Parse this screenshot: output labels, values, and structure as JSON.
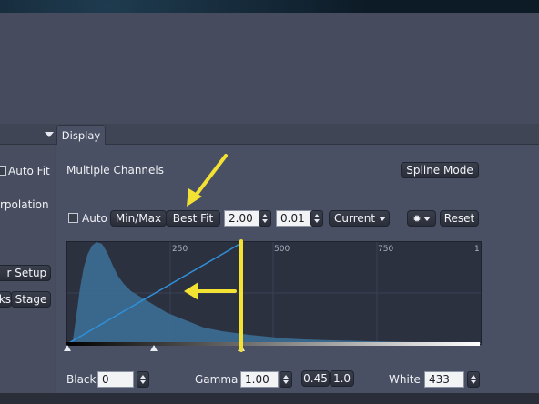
{
  "left_panel": {
    "auto_fit_label": "Auto Fit",
    "interpolation_label": "rpolation",
    "setup_button": "r Setup",
    "marks_button": "ks",
    "stage_button": "Stage"
  },
  "tabs": {
    "display": "Display"
  },
  "display": {
    "title": "Multiple Channels",
    "spline_mode_button": "Spline Mode",
    "auto_label": "Auto",
    "min_max_button": "Min/Max",
    "best_fit_button": "Best Fit",
    "value_1": "2.00",
    "value_2": "0.01",
    "current_dropdown": "Current",
    "reset_button": "Reset",
    "histogram_ticks": [
      "250",
      "500",
      "750",
      "1"
    ],
    "black_label": "Black",
    "black_value": "0",
    "gamma_label": "Gamma",
    "gamma_value": "1.00",
    "gamma_preset_1": "0.45",
    "gamma_preset_2": "1.0",
    "white_label": "White",
    "white_value": "433"
  },
  "colors": {
    "histogram_fill": "#3c6f95",
    "curve_line": "#2f8fd8",
    "annotation_yellow": "#f3e233"
  },
  "icons": [
    "settings-gear-icon",
    "dropdown-arrow-icon",
    "spinner-icon",
    "collapse-triangle-icon"
  ]
}
